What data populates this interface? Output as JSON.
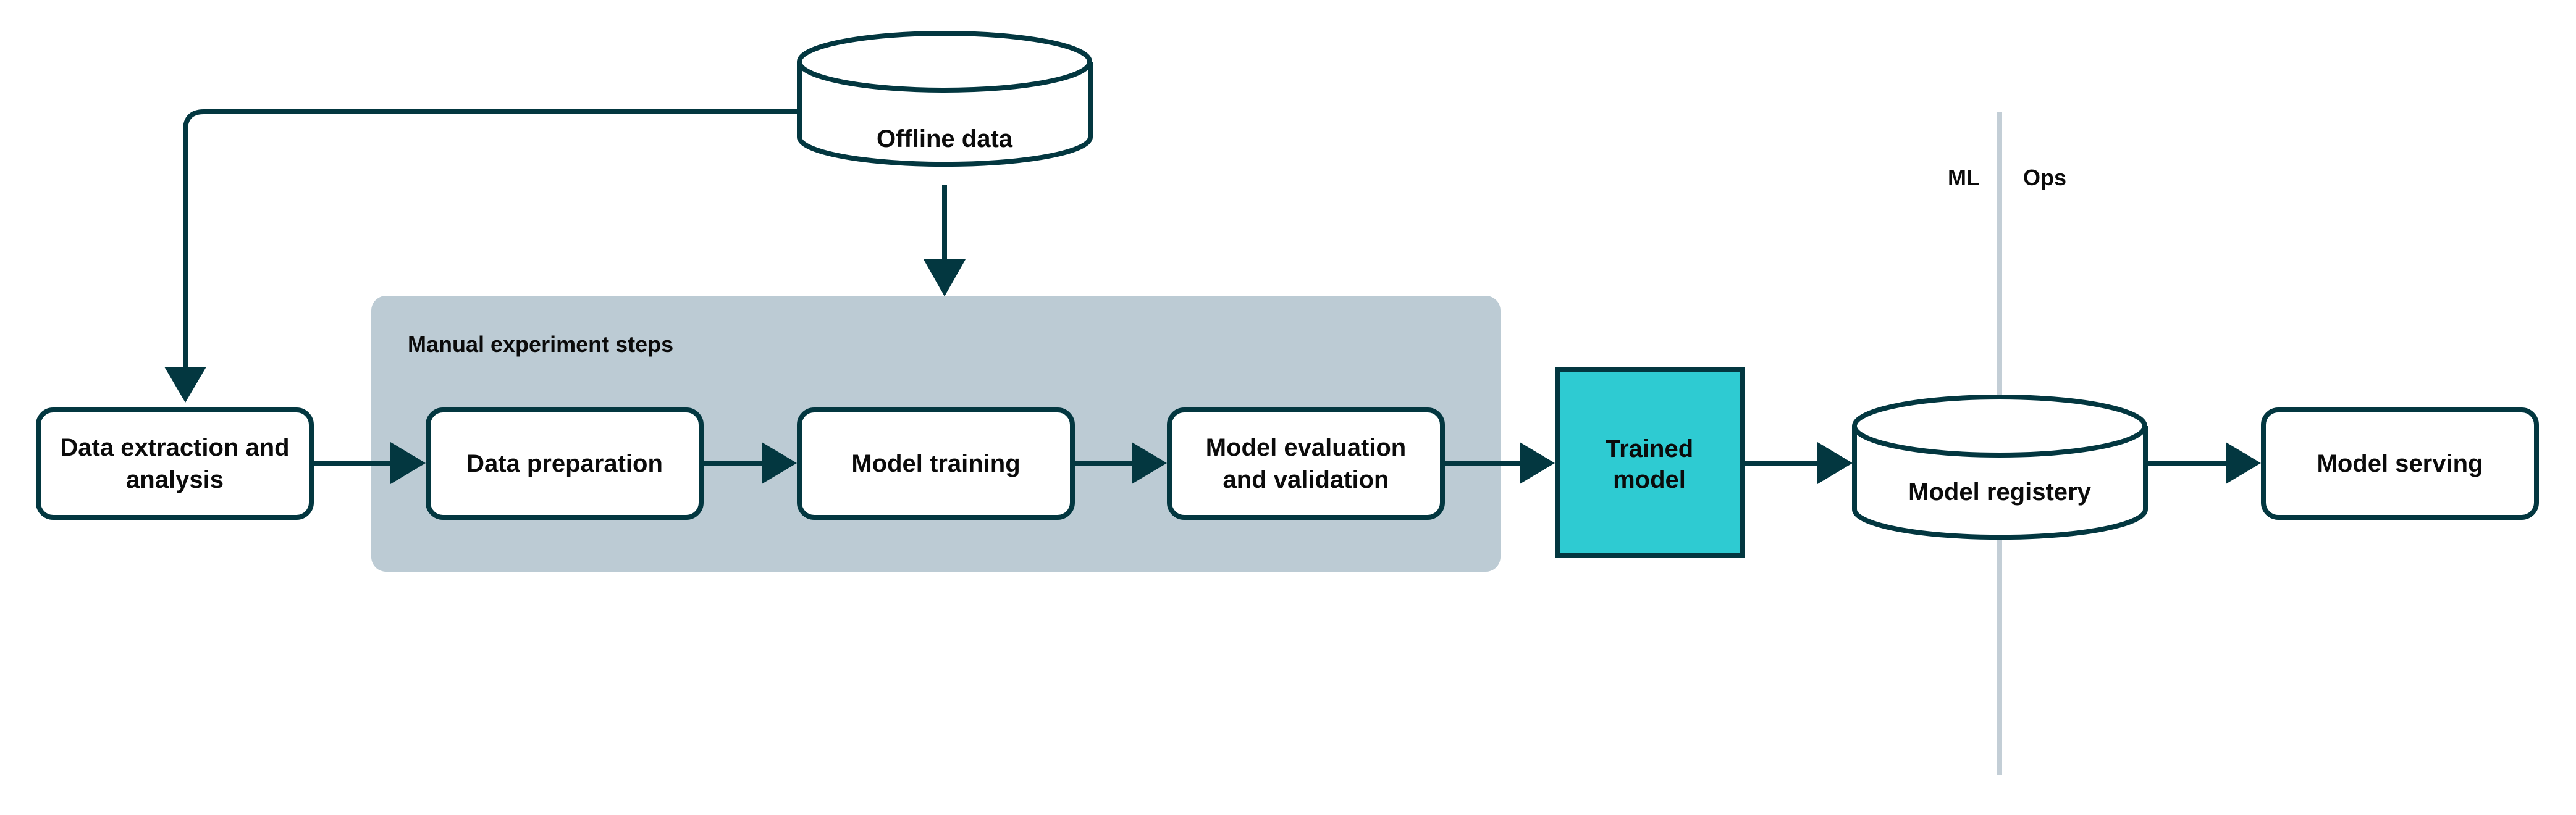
{
  "colors": {
    "line": "#033740",
    "panel": "#bccbd4",
    "trained_model_fill": "#2ecbd2",
    "divider": "#c3ced6"
  },
  "nodes": {
    "offline_data": {
      "label": "Offline data"
    },
    "data_extraction": {
      "lines": [
        "Data extraction and",
        "analysis"
      ]
    },
    "data_preparation": {
      "label": "Data preparation"
    },
    "model_training": {
      "label": "Model training"
    },
    "model_evaluation": {
      "lines": [
        "Model evaluation",
        "and validation"
      ]
    },
    "trained_model": {
      "lines": [
        "Trained",
        "model"
      ]
    },
    "model_registry": {
      "label": "Model registery"
    },
    "model_serving": {
      "label": "Model serving"
    }
  },
  "panel": {
    "title": "Manual experiment steps"
  },
  "divider": {
    "left_label": "ML",
    "right_label": "Ops"
  }
}
